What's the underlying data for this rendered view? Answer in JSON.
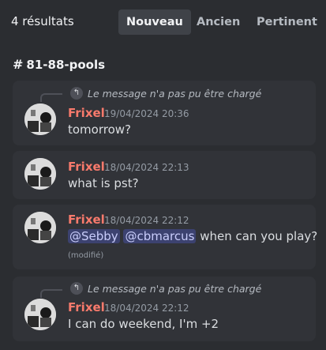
{
  "results": {
    "count_label": "4 résultats"
  },
  "tabs": [
    {
      "label": "Nouveau",
      "active": true
    },
    {
      "label": "Ancien",
      "active": false
    },
    {
      "label": "Pertinent",
      "active": false
    }
  ],
  "channel": {
    "name": "81-88-pools"
  },
  "messages": [
    {
      "reply_text": "Le message n'a pas pu être chargé",
      "author": "Frixel",
      "timestamp": "19/04/2024 20:36",
      "text": "tomorrow?"
    },
    {
      "author": "Frixel",
      "timestamp": "18/04/2024 22:13",
      "text": "what is pst?"
    },
    {
      "author": "Frixel",
      "timestamp": "18/04/2024 22:12",
      "mentions": [
        "@Sebby",
        "@cbmarcus"
      ],
      "text": "when can you play?",
      "edited_label": "(modifié)"
    },
    {
      "reply_text": "Le message n'a pas pu être chargé",
      "author": "Frixel",
      "timestamp": "18/04/2024 22:12",
      "text": "I can do weekend, I'm +2"
    }
  ],
  "colors": {
    "author": "#f87a6c",
    "mention_bg": "#3c4270",
    "background": "#2b2d31",
    "card": "#313338"
  }
}
